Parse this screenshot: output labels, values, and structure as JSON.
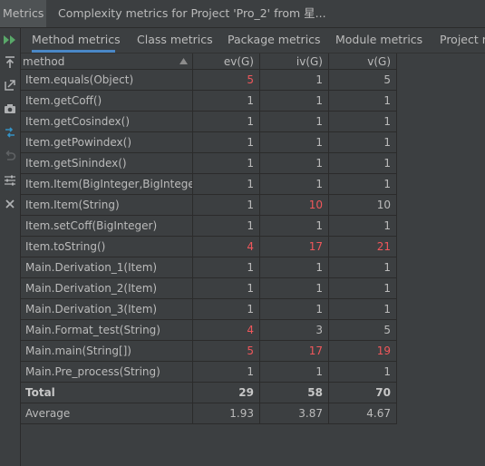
{
  "window": {
    "tool_label": "Metrics",
    "tab_title": "Complexity metrics for Project 'Pro_2' from 星..."
  },
  "tabs": [
    {
      "label": "Method metrics",
      "active": true
    },
    {
      "label": "Class metrics",
      "active": false
    },
    {
      "label": "Package metrics",
      "active": false
    },
    {
      "label": "Module metrics",
      "active": false
    },
    {
      "label": "Project m",
      "active": false
    }
  ],
  "table": {
    "headers": [
      "method",
      "ev(G)",
      "iv(G)",
      "v(G)"
    ],
    "rows": [
      {
        "method": "Item.equals(Object)",
        "ev": "5",
        "iv": "1",
        "v": "5",
        "hl": [
          true,
          false,
          false
        ]
      },
      {
        "method": "Item.getCoff()",
        "ev": "1",
        "iv": "1",
        "v": "1",
        "hl": [
          false,
          false,
          false
        ]
      },
      {
        "method": "Item.getCosindex()",
        "ev": "1",
        "iv": "1",
        "v": "1",
        "hl": [
          false,
          false,
          false
        ]
      },
      {
        "method": "Item.getPowindex()",
        "ev": "1",
        "iv": "1",
        "v": "1",
        "hl": [
          false,
          false,
          false
        ]
      },
      {
        "method": "Item.getSinindex()",
        "ev": "1",
        "iv": "1",
        "v": "1",
        "hl": [
          false,
          false,
          false
        ]
      },
      {
        "method": "Item.Item(BigInteger,BigInteger",
        "ev": "1",
        "iv": "1",
        "v": "1",
        "hl": [
          false,
          false,
          false
        ]
      },
      {
        "method": "Item.Item(String)",
        "ev": "1",
        "iv": "10",
        "v": "10",
        "hl": [
          false,
          true,
          false
        ]
      },
      {
        "method": "Item.setCoff(BigInteger)",
        "ev": "1",
        "iv": "1",
        "v": "1",
        "hl": [
          false,
          false,
          false
        ]
      },
      {
        "method": "Item.toString()",
        "ev": "4",
        "iv": "17",
        "v": "21",
        "hl": [
          true,
          true,
          true
        ]
      },
      {
        "method": "Main.Derivation_1(Item)",
        "ev": "1",
        "iv": "1",
        "v": "1",
        "hl": [
          false,
          false,
          false
        ]
      },
      {
        "method": "Main.Derivation_2(Item)",
        "ev": "1",
        "iv": "1",
        "v": "1",
        "hl": [
          false,
          false,
          false
        ]
      },
      {
        "method": "Main.Derivation_3(Item)",
        "ev": "1",
        "iv": "1",
        "v": "1",
        "hl": [
          false,
          false,
          false
        ]
      },
      {
        "method": "Main.Format_test(String)",
        "ev": "4",
        "iv": "3",
        "v": "5",
        "hl": [
          true,
          false,
          false
        ]
      },
      {
        "method": "Main.main(String[])",
        "ev": "5",
        "iv": "17",
        "v": "19",
        "hl": [
          true,
          true,
          true
        ]
      },
      {
        "method": "Main.Pre_process(String)",
        "ev": "1",
        "iv": "1",
        "v": "1",
        "hl": [
          false,
          false,
          false
        ]
      }
    ],
    "total": {
      "label": "Total",
      "ev": "29",
      "iv": "58",
      "v": "70"
    },
    "average": {
      "label": "Average",
      "ev": "1.93",
      "iv": "3.87",
      "v": "4.67"
    }
  },
  "toolbar_icons": [
    "run-icon",
    "export-icon",
    "open-external-icon",
    "camera-icon",
    "compare-icon",
    "undo-icon",
    "settings-sliders-icon",
    "close-icon"
  ],
  "colors": {
    "highlight": "#f0575b",
    "accent": "#4a88c7",
    "run": "#59a869"
  }
}
